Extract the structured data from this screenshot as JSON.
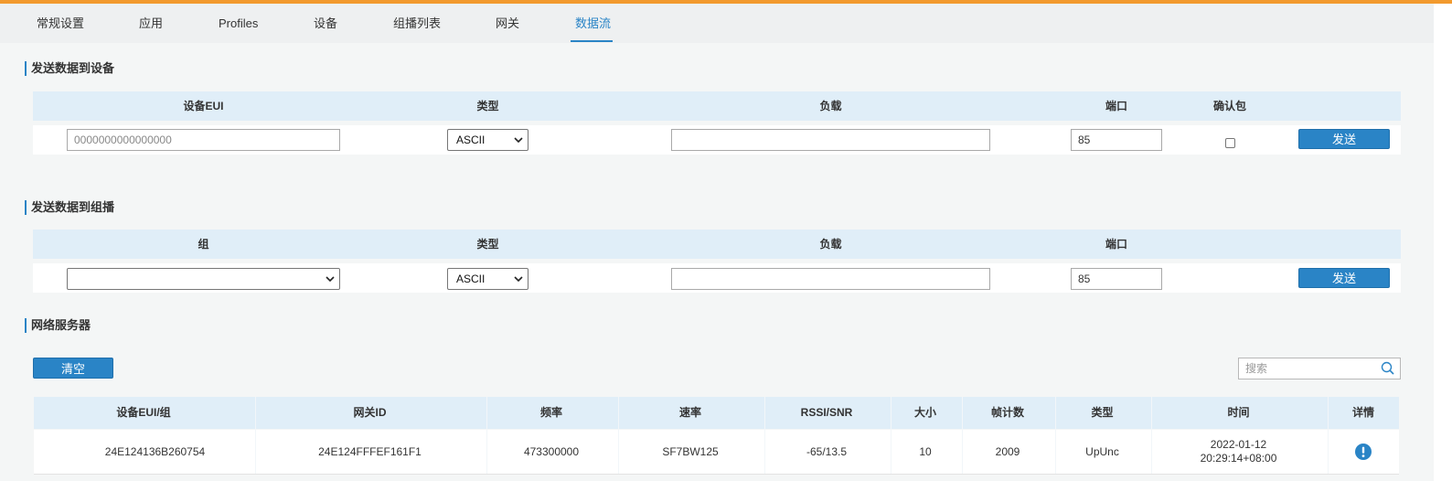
{
  "tabs": [
    {
      "label": "常规设置"
    },
    {
      "label": "应用"
    },
    {
      "label": "Profiles"
    },
    {
      "label": "设备"
    },
    {
      "label": "组播列表"
    },
    {
      "label": "网关"
    },
    {
      "label": "数据流",
      "active": true
    }
  ],
  "send_device": {
    "title": "发送数据到设备",
    "columns": [
      "设备EUI",
      "类型",
      "负载",
      "端口",
      "确认包"
    ],
    "eui_placeholder": "0000000000000000",
    "type_value": "ASCII",
    "payload_value": "",
    "port_value": "85",
    "confirm_checked": false,
    "send_label": "发送"
  },
  "send_multicast": {
    "title": "发送数据到组播",
    "columns": [
      "组",
      "类型",
      "负载",
      "端口"
    ],
    "group_value": "",
    "type_value": "ASCII",
    "payload_value": "",
    "port_value": "85",
    "send_label": "发送"
  },
  "network_server": {
    "title": "网络服务器",
    "clear_label": "清空",
    "search_placeholder": "搜索",
    "columns": [
      "设备EUI/组",
      "网关ID",
      "频率",
      "速率",
      "RSSI/SNR",
      "大小",
      "帧计数",
      "类型",
      "时间",
      "详情"
    ],
    "rows": [
      {
        "eui": "24E124136B260754",
        "gateway_id": "24E124FFFEF161F1",
        "frequency": "473300000",
        "rate": "SF7BW125",
        "rssi_snr": "-65/13.5",
        "size": "10",
        "fcnt": "2009",
        "type": "UpUnc",
        "time_date": "2022-01-12",
        "time_clock": "20:29:14+08:00",
        "detail_icon": "info-icon"
      }
    ]
  },
  "colors": {
    "accent": "#2a84c6",
    "top_bar": "#f29a2e",
    "header_bg": "#e0eef8"
  }
}
